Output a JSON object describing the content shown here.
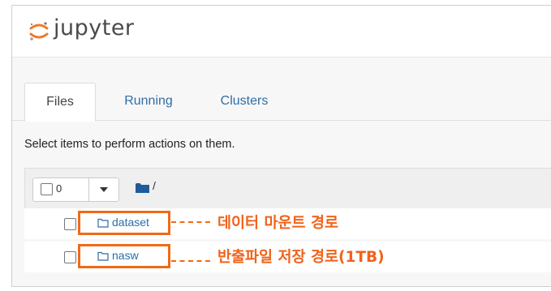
{
  "app": {
    "logo_text": "jupyter"
  },
  "tabs": [
    {
      "label": "Files",
      "active": true
    },
    {
      "label": "Running",
      "active": false
    },
    {
      "label": "Clusters",
      "active": false
    }
  ],
  "hint_text": "Select items to perform actions on them.",
  "toolbar": {
    "selected_count": "0",
    "path_text": "/"
  },
  "files": [
    {
      "name": "dataset",
      "type": "folder",
      "annotation": "데이터 마운트 경로"
    },
    {
      "name": "nasw",
      "type": "folder",
      "annotation": "반출파일 저장 경로(1TB)"
    }
  ],
  "colors": {
    "link": "#2b6ea7",
    "annotation": "#f0631a",
    "jupyter_orange": "#f37726"
  }
}
